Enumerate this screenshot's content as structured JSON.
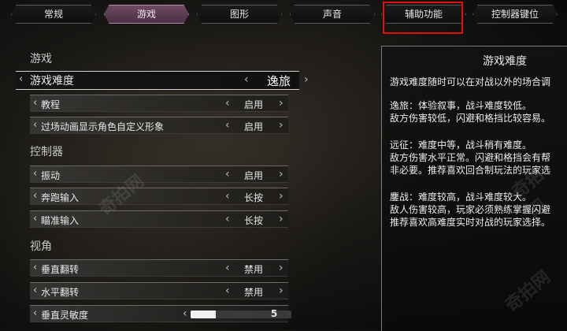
{
  "tabs": [
    "常规",
    "游戏",
    "图形",
    "声音",
    "辅助功能",
    "控制器键位"
  ],
  "sections": {
    "game": "游戏",
    "controller": "控制器",
    "view": "视角"
  },
  "settings": {
    "difficulty": {
      "label": "游戏难度",
      "value": "逸旅"
    },
    "tutorial": {
      "label": "教程",
      "value": "启用"
    },
    "cutscene_custom": {
      "label": "过场动画显示角色自定义形象",
      "value": "启用"
    },
    "vibration": {
      "label": "振动",
      "value": "启用"
    },
    "sprint_input": {
      "label": "奔跑输入",
      "value": "长按"
    },
    "aim_input": {
      "label": "瞄准输入",
      "value": "长按"
    },
    "invert_y": {
      "label": "垂直翻转",
      "value": "禁用"
    },
    "invert_x": {
      "label": "水平翻转",
      "value": "禁用"
    },
    "vertical_sensitivity": {
      "label": "垂直灵敏度",
      "value": "5",
      "fill_fraction": 0.25
    }
  },
  "info_panel": {
    "title": "游戏难度",
    "lines": [
      "游戏难度随时可以在对战以外的场合调",
      "逸旅：体验叙事，战斗难度较低。",
      "敌方伤害较低，闪避和格挡比较容易。",
      "远征：难度中等，战斗稍有难度。",
      "敌方伤害水平正常。闪避和格挡会有帮",
      "非必要。推荐喜欢回合制玩法的玩家选",
      "鏖战：难度较高，战斗难度较大。",
      "敌人伤害较高，玩家必须熟练掌握闪避",
      "推荐喜欢高难度实时对战的玩家选择。"
    ]
  },
  "watermark": "奇拍网",
  "colors": {
    "active_tab": "#6d4a63",
    "highlight_box": "#e01010"
  }
}
